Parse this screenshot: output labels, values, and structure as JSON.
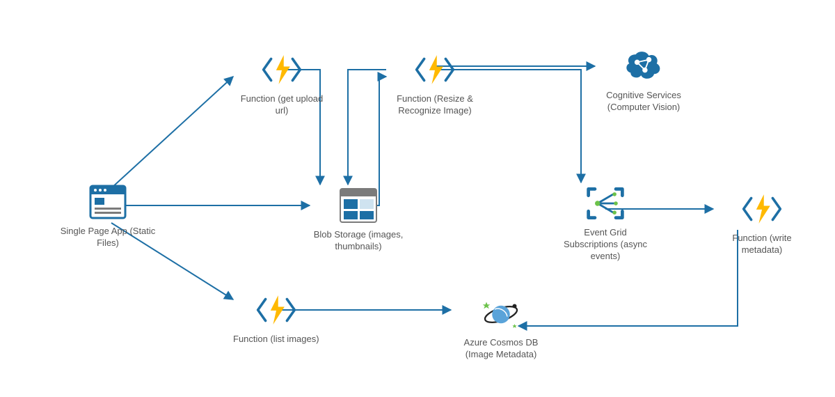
{
  "nodes": {
    "spa": {
      "label": "Single Page App (Static Files)"
    },
    "fn_upload": {
      "label": "Function (get upload url)"
    },
    "fn_resize": {
      "label": "Function (Resize & Recognize Image)"
    },
    "cognitive": {
      "label": "Cognitive Services (Computer Vision)"
    },
    "blob": {
      "label": "Blob Storage (images, thumbnails)"
    },
    "eventgrid": {
      "label": "Event Grid Subscriptions (async events)"
    },
    "fn_write": {
      "label": "Function (write metadata)"
    },
    "fn_list": {
      "label": "Function (list images)"
    },
    "cosmos": {
      "label": "Azure Cosmos DB (Image Metadata)"
    }
  },
  "colors": {
    "arrow": "#1d6fa5",
    "azureBlue": "#1d6fa5",
    "bolt": "#ffb900",
    "grey": "#7b7b7b"
  },
  "edges": [
    {
      "from": "spa",
      "to": "fn_upload"
    },
    {
      "from": "spa",
      "to": "blob"
    },
    {
      "from": "spa",
      "to": "fn_list"
    },
    {
      "from": "fn_upload",
      "to": "blob"
    },
    {
      "from": "blob",
      "to": "fn_resize"
    },
    {
      "from": "fn_resize",
      "to": "blob"
    },
    {
      "from": "fn_resize",
      "to": "cognitive"
    },
    {
      "from": "fn_resize",
      "to": "eventgrid"
    },
    {
      "from": "eventgrid",
      "to": "fn_write"
    },
    {
      "from": "fn_write",
      "to": "cosmos"
    },
    {
      "from": "fn_list",
      "to": "cosmos"
    }
  ]
}
